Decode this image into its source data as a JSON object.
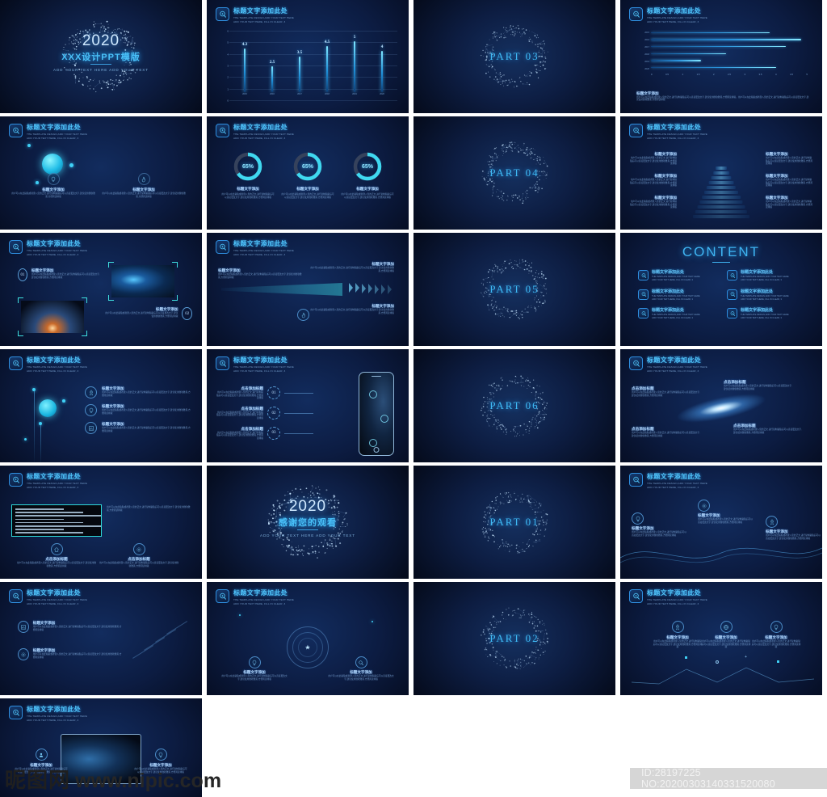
{
  "page": {
    "watermark_cn": "昵图网",
    "watermark_url": "www.nipic.com",
    "id_text": "ID:28197225 NO:20200303140331520080"
  },
  "common": {
    "header_title": "标题文字添加此处",
    "header_sub_line1": "THE TEMPLATE DESIGN,ADD YOUR TEXT HERE",
    "header_sub_line2": "ADD YOUR TEXT HERE, FILL IN CLEAR, 3",
    "sub_title": "标题文字添加",
    "click_title": "点击添加标题",
    "body_text": "用户可以在此粘贴或者键入您的正文,进行复制粘贴后可以直接更改文字,建议使用微软雅黑,方便阅读排版",
    "badge_icon": "target-search-icon"
  },
  "slides": [
    {
      "id": "cover",
      "type": "cover",
      "year": "2020",
      "title": "XXX设计PPT模版",
      "subtitle": "ADD YOUR TEXT HERE ADD YOUR TEXT"
    },
    {
      "id": "column-chart",
      "type": "column-chart",
      "chart_index": 0
    },
    {
      "id": "part-03",
      "type": "part",
      "label": "PART  03"
    },
    {
      "id": "hbar-chart",
      "type": "hbar-chart",
      "chart_index": 1,
      "foot_title": "标题文字添加",
      "foot_body": "用户可以在此粘贴或者键入您的正文,进行复制粘贴后可以直接更改文字,建议使用微软雅黑,方便阅读排版。用户可以在此粘贴或者键入您的正文,进行复制粘贴后可以直接更改文字,建议使用微软雅黑,方便阅读排版"
    },
    {
      "id": "bubble-two-col",
      "type": "bubble-two-col",
      "items": [
        {
          "icon": "lightbulb-icon",
          "title": "标题文字添加"
        },
        {
          "icon": "hand-click-icon",
          "title": "标题文字添加"
        }
      ]
    },
    {
      "id": "donuts",
      "type": "donuts",
      "chart_index": 2,
      "items": [
        {
          "pct": "65%",
          "value": 65,
          "title": "标题文字添加"
        },
        {
          "pct": "65%",
          "value": 65,
          "title": "标题文字添加"
        },
        {
          "pct": "65%",
          "value": 65,
          "title": "标题文字添加"
        }
      ]
    },
    {
      "id": "part-04",
      "type": "part",
      "label": "PART  04"
    },
    {
      "id": "pyramid",
      "type": "pyramid",
      "left_items": [
        "标题文字添加",
        "标题文字添加",
        "标题文字添加"
      ],
      "right_items": [
        "标题文字添加",
        "标题文字添加",
        "标题文字添加"
      ]
    },
    {
      "id": "space-images",
      "type": "space-images",
      "items": [
        {
          "num": "01",
          "title": "标题文字添加"
        },
        {
          "num": "02",
          "title": "标题文字添加"
        }
      ]
    },
    {
      "id": "arrow-funnel",
      "type": "arrow-funnel",
      "items": [
        {
          "icon": "lightbulb-icon",
          "title": "标题文字添加"
        },
        {
          "icon": "hand-click-icon",
          "title": "标题文字添加"
        },
        {
          "icon": "gear-icon",
          "title": "标题文字添加"
        }
      ]
    },
    {
      "id": "part-05",
      "type": "part",
      "label": "PART  05"
    },
    {
      "id": "content",
      "type": "content",
      "heading": "CONTENT",
      "items": [
        {
          "title": "标题文字添加此处"
        },
        {
          "title": "标题文字添加此处"
        },
        {
          "title": "标题文字添加此处"
        },
        {
          "title": "标题文字添加此处"
        },
        {
          "title": "标题文字添加此处"
        },
        {
          "title": "标题文字添加此处"
        }
      ]
    },
    {
      "id": "icon-list",
      "type": "icon-list",
      "items": [
        {
          "icon": "rocket-icon",
          "title": "标题文字添加"
        },
        {
          "icon": "bulb-hand-icon",
          "title": "标题文字添加"
        },
        {
          "icon": "chart-icon",
          "title": "标题文字添加"
        }
      ]
    },
    {
      "id": "phone-steps",
      "type": "phone-steps",
      "items": [
        {
          "num": "01",
          "title": "点击添加标题"
        },
        {
          "num": "02",
          "title": "点击添加标题"
        },
        {
          "num": "03",
          "title": "点击添加标题"
        }
      ]
    },
    {
      "id": "part-06",
      "type": "part",
      "label": "PART  06"
    },
    {
      "id": "galaxy",
      "type": "galaxy",
      "items": [
        {
          "title": "点击添加标题"
        },
        {
          "title": "点击添加标题"
        },
        {
          "title": "点击添加标题"
        },
        {
          "title": "点击添加标题"
        }
      ]
    },
    {
      "id": "film-strip",
      "type": "film-strip",
      "items": [
        {
          "icon": "home-icon",
          "title": "点击添加标题"
        },
        {
          "icon": "gear-icon",
          "title": "点击添加标题"
        }
      ]
    },
    {
      "id": "thanks",
      "type": "thanks",
      "year": "2020",
      "title": "感谢您的观看",
      "subtitle": "ADD YOUR TEXT HERE ADD YOUR TEXT"
    },
    {
      "id": "part-01",
      "type": "part",
      "label": "PART  01"
    },
    {
      "id": "wave",
      "type": "wave",
      "items": [
        {
          "icon": "bulb-icon",
          "title": "标题文字添加"
        },
        {
          "icon": "gear-icon",
          "title": "标题文字添加"
        },
        {
          "icon": "rocket-icon",
          "title": "标题文字添加"
        }
      ]
    },
    {
      "id": "two-row-list",
      "type": "two-row-list",
      "items": [
        {
          "icon": "chart-icon",
          "title": "标题文字添加"
        },
        {
          "icon": "gear-icon",
          "title": "标题文字添加"
        }
      ]
    },
    {
      "id": "orbit",
      "type": "orbit",
      "items": [
        {
          "icon": "bulb-icon",
          "title": "标题文字添加"
        },
        {
          "icon": "search-icon",
          "title": "标题文字添加"
        }
      ]
    },
    {
      "id": "part-02",
      "type": "part",
      "label": "PART  02"
    },
    {
      "id": "three-icons",
      "type": "three-icons",
      "items": [
        {
          "icon": "rocket-icon",
          "title": "标题文字添加"
        },
        {
          "icon": "globe-icon",
          "title": "标题文字添加"
        },
        {
          "icon": "bulb-icon",
          "title": "标题文字添加"
        }
      ]
    },
    {
      "id": "laptop",
      "type": "laptop",
      "items": [
        {
          "icon": "user-icon",
          "title": "标题文字添加"
        },
        {
          "icon": "bulb-icon",
          "title": "标题文字添加"
        }
      ]
    }
  ],
  "chart_data": [
    {
      "type": "bar",
      "orientation": "vertical",
      "title": "标题文字添加此处",
      "categories": [
        "2015",
        "2016",
        "2017",
        "2018",
        "2019",
        "2020"
      ],
      "values": [
        4.3,
        2.5,
        3.5,
        4.5,
        5,
        4
      ],
      "data_labels": [
        "4.3",
        "2.5",
        "3.5",
        "4.5",
        "5",
        "4"
      ],
      "yticks": [
        "0",
        "1",
        "2",
        "3",
        "4",
        "5",
        "6"
      ],
      "ylim": [
        0,
        6
      ],
      "xlabel": "",
      "ylabel": "",
      "grid": true,
      "legend": "none"
    },
    {
      "type": "bar",
      "orientation": "horizontal",
      "title": "标题文字添加此处",
      "categories": [
        "2015",
        "2016",
        "2017",
        "2018",
        "2019",
        "2020"
      ],
      "values": [
        3.8,
        4.8,
        4.3,
        2.4,
        1.6,
        4.0
      ],
      "xticks": [
        "0",
        "0.5",
        "1",
        "1.5",
        "2",
        "2.5",
        "3",
        "3.5",
        "4",
        "4.5",
        "5"
      ],
      "xlim": [
        0,
        5
      ],
      "xlabel": "",
      "ylabel": "",
      "grid": false,
      "legend": "none"
    },
    {
      "type": "pie",
      "subtype": "donut",
      "title": "标题文字添加此处",
      "series": [
        {
          "name": "标题文字添加",
          "value": 65,
          "label": "65%"
        },
        {
          "name": "标题文字添加",
          "value": 65,
          "label": "65%"
        },
        {
          "name": "标题文字添加",
          "value": 65,
          "label": "65%"
        }
      ],
      "colors": {
        "filled": "#3fd8f0",
        "track": "#36425c"
      }
    }
  ]
}
